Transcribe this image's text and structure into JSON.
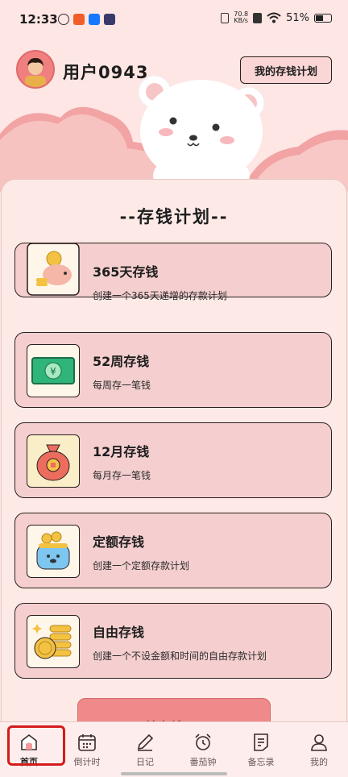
{
  "status_bar": {
    "time": "12:33",
    "net_speed_value": "70.8",
    "net_speed_unit": "KB/s",
    "battery": "51%"
  },
  "header": {
    "username": "用户0943",
    "plan_button": "我的存钱计划"
  },
  "main": {
    "section_title": "--存钱计划--",
    "plans": [
      {
        "title": "365天存钱",
        "desc": "创建一个365天递增的存款计划",
        "icon": "piggy-bank-icon"
      },
      {
        "title": "52周存钱",
        "desc": "每周存一笔钱",
        "icon": "banknote-icon"
      },
      {
        "title": "12月存钱",
        "desc": "每月存一笔钱",
        "icon": "money-bag-icon"
      },
      {
        "title": "定额存钱",
        "desc": "创建一个定额存款计划",
        "icon": "coin-purse-icon"
      },
      {
        "title": "自由存钱",
        "desc": "创建一个不设金额和时间的自由存款计划",
        "icon": "coin-stack-icon"
      }
    ],
    "start_button": "开始存钱 GO!"
  },
  "nav": {
    "items": [
      {
        "label": "首页",
        "icon": "home-icon"
      },
      {
        "label": "倒计时",
        "icon": "calendar-icon"
      },
      {
        "label": "日记",
        "icon": "pencil-icon"
      },
      {
        "label": "番茄钟",
        "icon": "alarm-clock-icon"
      },
      {
        "label": "备忘录",
        "icon": "memo-icon"
      },
      {
        "label": "我的",
        "icon": "user-icon"
      }
    ]
  },
  "colors": {
    "background": "#fde6e4",
    "card": "#f5cfcf",
    "accent": "#f08a8a",
    "highlight": "#d41b1b"
  }
}
